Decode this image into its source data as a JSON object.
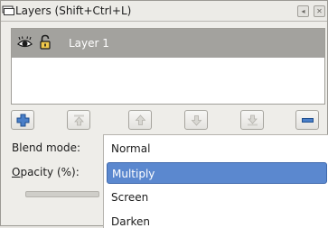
{
  "window": {
    "title": "Layers (Shift+Ctrl+L)",
    "controls": [
      "restore",
      "close"
    ]
  },
  "layers": [
    {
      "name": "Layer 1",
      "visible": true,
      "locked": false,
      "selected": true
    }
  ],
  "toolbar": {
    "buttons": [
      {
        "name": "add-layer",
        "enabled": true
      },
      {
        "name": "raise-to-top",
        "enabled": false
      },
      {
        "name": "raise-layer",
        "enabled": false
      },
      {
        "name": "lower-layer",
        "enabled": false
      },
      {
        "name": "lower-to-bottom",
        "enabled": false
      },
      {
        "name": "remove-layer",
        "enabled": true
      }
    ]
  },
  "blend": {
    "label": "Blend mode:",
    "options": [
      "Normal",
      "Multiply",
      "Screen",
      "Darken"
    ],
    "highlighted": "Multiply"
  },
  "opacity": {
    "label": "Opacity (%):",
    "mnemonic": "O",
    "label_rest": "pacity (%):"
  },
  "colors": {
    "selected_row": "#a3a29e",
    "highlight": "#5b88cf",
    "add_icon": "#3c6fb6"
  }
}
